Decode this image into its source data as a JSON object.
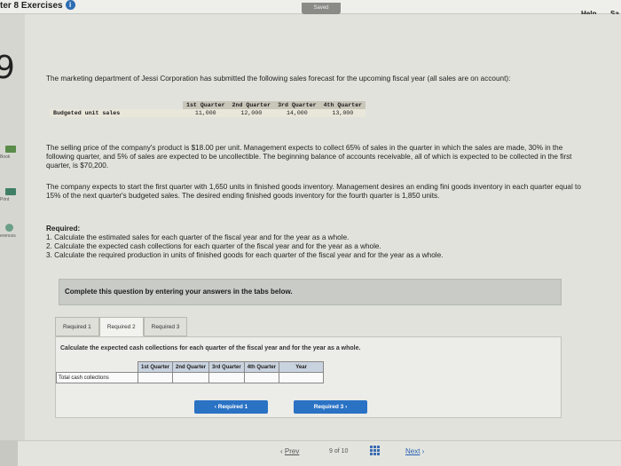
{
  "header": {
    "chapter_title": "ter 8 Exercises",
    "saved_label": "Saved",
    "help_label": "Help",
    "save_label": "Sa"
  },
  "sidebar": {
    "question_number": "9",
    "items": [
      {
        "label": "Book",
        "icon": "book-icon"
      },
      {
        "label": "Print",
        "icon": "print-icon"
      },
      {
        "label": "erences",
        "icon": "references-icon"
      }
    ]
  },
  "problem": {
    "intro": "The marketing department of Jessi Corporation has submitted the following sales forecast for the upcoming fiscal year (all sales are on account):",
    "budget_table": {
      "columns": [
        "1st Quarter",
        "2nd Quarter",
        "3rd Quarter",
        "4th Quarter"
      ],
      "row_label": "Budgeted unit sales",
      "values": [
        "11,000",
        "12,000",
        "14,000",
        "13,000"
      ]
    },
    "price_text": "The selling price of the company's product is $18.00 per unit. Management expects to collect 65% of sales in the quarter in which the sales are made, 30% in the following quarter, and 5% of sales are expected to be uncollectible. The beginning balance of accounts receivable, all of which is expected to be collected in the first quarter, is $70,200.",
    "inventory_text": "The company expects to start the first quarter with 1,650 units in finished goods inventory. Management desires an ending fini goods inventory in each quarter equal to 15% of the next quarter's budgeted sales. The desired ending finished goods inventory for the fourth quarter is 1,850 units.",
    "required_heading": "Required:",
    "required_items": [
      "1. Calculate the estimated sales for each quarter of the fiscal year and for the year as a whole.",
      "2. Calculate the expected cash collections for each quarter of the fiscal year and for the year as a whole.",
      "3. Calculate the required production in units of finished goods for each quarter of the fiscal year and for the year as a whole."
    ]
  },
  "instruction": "Complete this question by entering your answers in the tabs below.",
  "tabs": [
    "Required 1",
    "Required 2",
    "Required 3"
  ],
  "panel": {
    "prompt": "Calculate the expected cash collections for each quarter of the fiscal year and for the year as a whole.",
    "columns": [
      "1st Quarter",
      "2nd Quarter",
      "3rd Quarter",
      "4th Quarter",
      "Year"
    ],
    "row_label": "Total cash collections",
    "values": [
      "",
      "",
      "",
      "",
      ""
    ],
    "prev_button": "Required 1",
    "next_button": "Required 3"
  },
  "footer": {
    "prev_label": "Prev",
    "page_current": "9",
    "page_of": "of 10",
    "next_label": "Next"
  },
  "colors": {
    "accent": "#2a72c4",
    "saved_badge": "#8a8a86",
    "table_header": "#c9d3df"
  }
}
